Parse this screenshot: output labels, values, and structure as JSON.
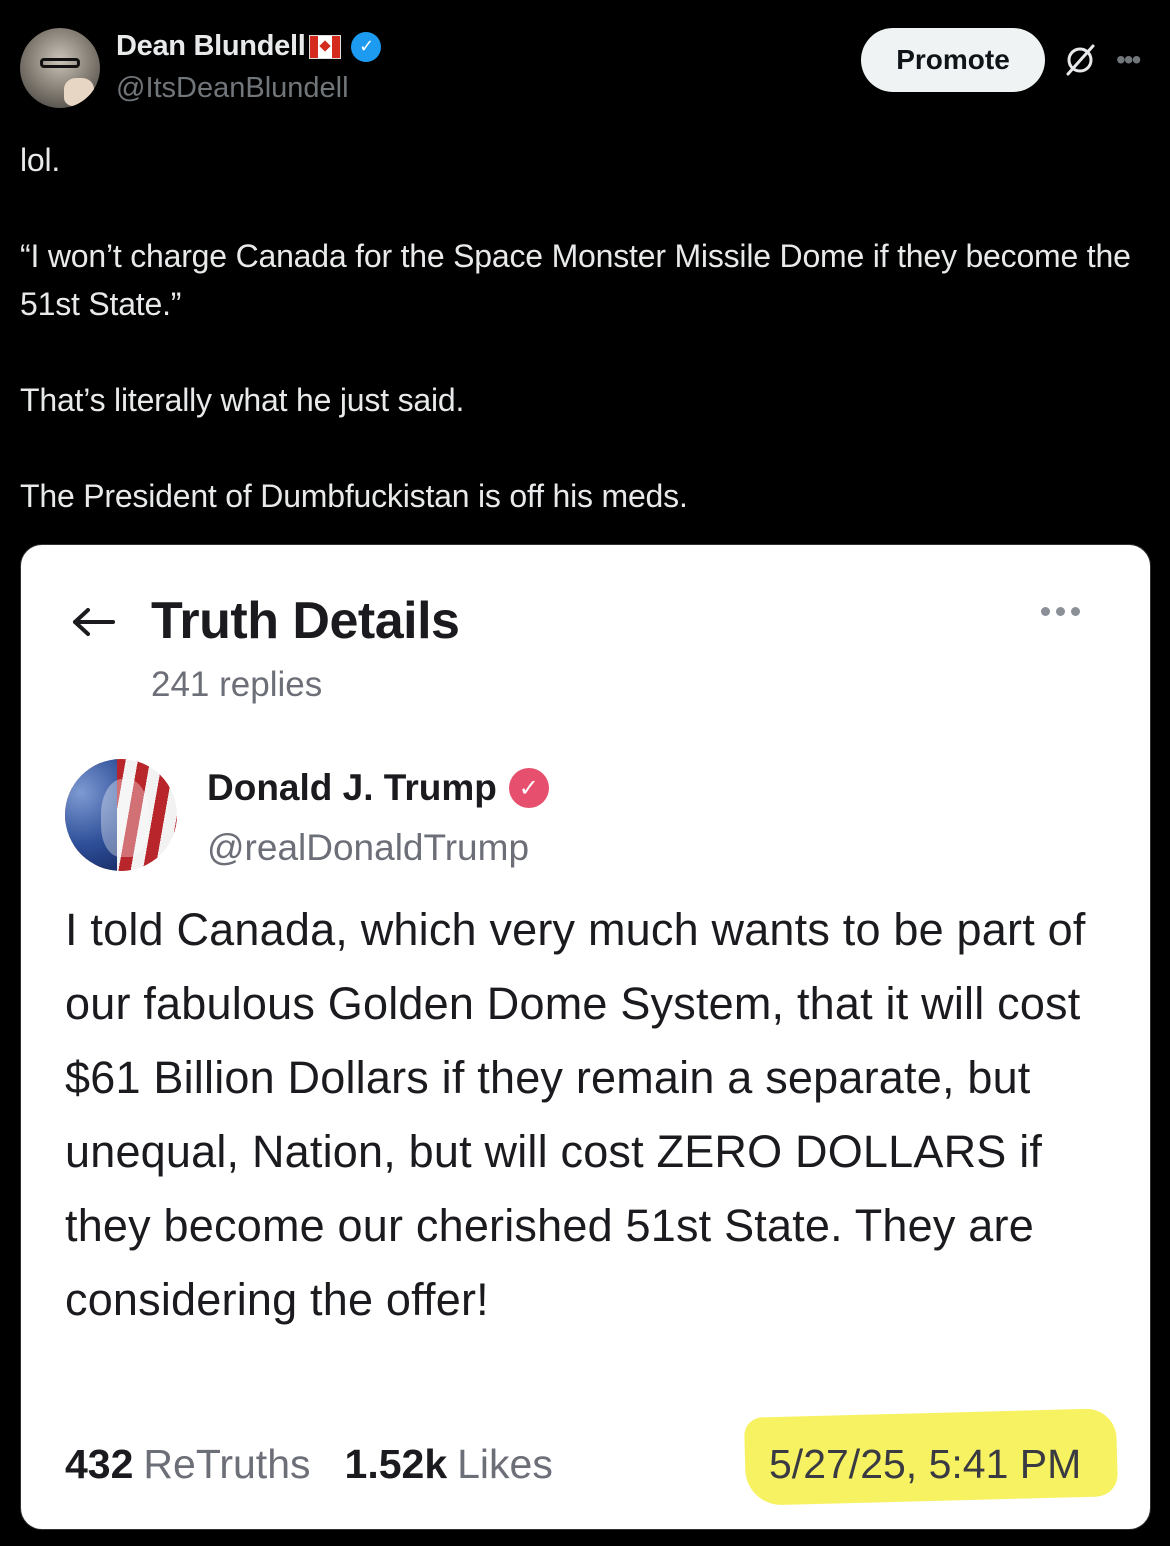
{
  "author": {
    "name": "Dean Blundell",
    "handle": "@ItsDeanBlundell"
  },
  "header": {
    "promote_label": "Promote"
  },
  "tweet": {
    "text": "lol.\n\n“I won’t charge Canada for the Space Monster Missile Dome if they become the 51st State.”\n\nThat’s literally what he just said.\n\nThe President of Dumbfuckistan is off his meds."
  },
  "embedded": {
    "title": "Truth Details",
    "replies": "241 replies",
    "author_name": "Donald J. Trump",
    "author_handle": "@realDonaldTrump",
    "body": "I told Canada, which very much wants to be part of our fabulous Golden Dome System, that it will cost $61 Billion Dollars if they remain a separate, but unequal, Nation, but will cost ZERO DOLLARS if they become our cherished 51st State. They are considering the offer!",
    "retruths_count": "432",
    "retruths_label": "ReTruths",
    "likes_count": "1.52k",
    "likes_label": "Likes",
    "timestamp": "5/27/25, 5:41 PM",
    "highlight_color": "#f7f262"
  },
  "colors": {
    "verified_blue": "#1d9bf0",
    "truth_verified": "#e64f6d"
  },
  "icons": [
    "avatar",
    "canada-flag-icon",
    "verified-icon",
    "grok-icon",
    "more-icon",
    "back-arrow-icon",
    "truth-verified-icon"
  ]
}
